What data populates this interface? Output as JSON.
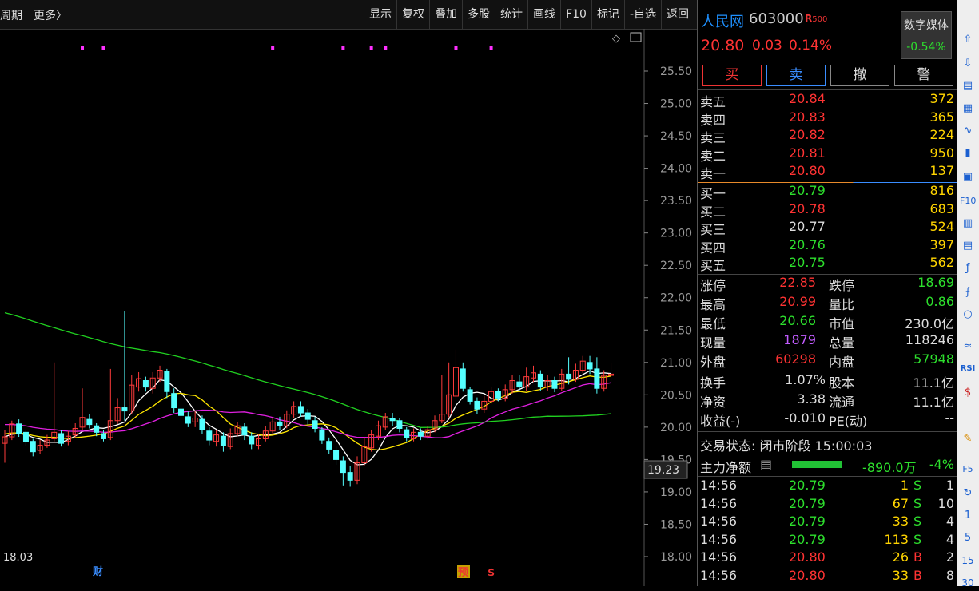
{
  "top": {
    "period": "周期",
    "more": "更多〉",
    "toolbar": [
      "显示",
      "复权",
      "叠加",
      "多股",
      "统计",
      "画线",
      "F10",
      "标记",
      "-自选",
      "返回"
    ]
  },
  "chart_data": {
    "type": "candlestick",
    "y_ticks": [
      "25.50",
      "25.00",
      "24.50",
      "24.00",
      "23.50",
      "23.00",
      "22.50",
      "22.00",
      "21.50",
      "21.00",
      "20.50",
      "20.00",
      "19.50",
      "19.00",
      "18.50",
      "18.00"
    ],
    "ylim": [
      18.0,
      25.5
    ],
    "current_price_label": "19.23",
    "low_label": "18.03",
    "markers": [
      "财",
      "预",
      "$"
    ],
    "candles": [
      [
        19.75,
        19.85,
        19.45,
        19.95
      ],
      [
        19.85,
        20.05,
        19.8,
        20.1
      ],
      [
        20.05,
        19.9,
        19.85,
        20.12
      ],
      [
        19.92,
        19.78,
        19.7,
        19.96
      ],
      [
        19.78,
        19.62,
        19.55,
        19.82
      ],
      [
        19.64,
        19.72,
        19.58,
        19.8
      ],
      [
        19.72,
        19.8,
        19.68,
        19.88
      ],
      [
        19.82,
        19.92,
        19.78,
        21.0
      ],
      [
        19.9,
        19.75,
        19.7,
        19.96
      ],
      [
        19.78,
        19.86,
        19.72,
        19.94
      ],
      [
        19.88,
        19.98,
        19.84,
        20.06
      ],
      [
        20.0,
        20.15,
        19.95,
        20.6
      ],
      [
        20.12,
        20.04,
        19.98,
        20.2
      ],
      [
        20.02,
        19.92,
        19.86,
        20.06
      ],
      [
        19.9,
        19.82,
        19.78,
        19.96
      ],
      [
        19.84,
        20.1,
        19.8,
        20.9
      ],
      [
        20.1,
        20.3,
        20.05,
        20.45
      ],
      [
        20.3,
        20.25,
        20.1,
        21.8
      ],
      [
        20.25,
        20.65,
        20.2,
        20.8
      ],
      [
        20.62,
        20.75,
        20.55,
        20.85
      ],
      [
        20.72,
        20.62,
        20.55,
        20.78
      ],
      [
        20.6,
        20.76,
        20.52,
        20.85
      ],
      [
        20.76,
        20.88,
        20.7,
        20.95
      ],
      [
        20.86,
        20.55,
        20.45,
        20.9
      ],
      [
        20.52,
        20.3,
        20.22,
        20.6
      ],
      [
        20.28,
        20.18,
        20.1,
        20.35
      ],
      [
        20.16,
        20.06,
        20.0,
        20.24
      ],
      [
        20.08,
        20.14,
        20.0,
        20.26
      ],
      [
        20.12,
        19.96,
        19.9,
        20.18
      ],
      [
        19.94,
        19.8,
        19.72,
        20.0
      ],
      [
        19.78,
        19.88,
        19.7,
        19.96
      ],
      [
        19.86,
        19.72,
        19.62,
        19.92
      ],
      [
        19.7,
        19.9,
        19.66,
        19.98
      ],
      [
        19.9,
        20.02,
        19.86,
        20.08
      ],
      [
        20.0,
        19.88,
        19.8,
        20.06
      ],
      [
        19.86,
        19.74,
        19.66,
        19.92
      ],
      [
        19.72,
        19.82,
        19.66,
        19.9
      ],
      [
        19.82,
        19.94,
        19.78,
        20.02
      ],
      [
        19.94,
        20.08,
        19.9,
        20.14
      ],
      [
        20.08,
        20.02,
        19.96,
        20.16
      ],
      [
        20.02,
        20.2,
        19.98,
        20.26
      ],
      [
        20.2,
        20.32,
        20.14,
        20.4
      ],
      [
        20.32,
        20.22,
        20.16,
        20.4
      ],
      [
        20.22,
        20.12,
        20.04,
        20.28
      ],
      [
        20.1,
        19.98,
        19.92,
        20.16
      ],
      [
        19.96,
        19.8,
        19.74,
        20.0
      ],
      [
        19.78,
        19.66,
        19.58,
        19.84
      ],
      [
        19.64,
        19.5,
        19.42,
        19.7
      ],
      [
        19.48,
        19.3,
        19.1,
        19.55
      ],
      [
        19.3,
        19.18,
        19.08,
        19.4
      ],
      [
        19.18,
        19.45,
        19.12,
        19.55
      ],
      [
        19.45,
        19.7,
        19.4,
        19.85
      ],
      [
        19.68,
        19.88,
        19.62,
        19.95
      ],
      [
        19.86,
        20.02,
        19.8,
        20.1
      ],
      [
        20.0,
        20.16,
        19.96,
        20.22
      ],
      [
        20.14,
        20.1,
        20.02,
        20.22
      ],
      [
        20.1,
        19.98,
        19.92,
        20.14
      ],
      [
        19.96,
        19.84,
        19.78,
        20.0
      ],
      [
        19.82,
        19.92,
        19.78,
        19.98
      ],
      [
        19.92,
        19.86,
        19.8,
        19.98
      ],
      [
        19.86,
        19.96,
        19.82,
        20.02
      ],
      [
        19.96,
        20.1,
        19.92,
        20.18
      ],
      [
        20.1,
        20.2,
        20.06,
        20.8
      ],
      [
        20.2,
        20.5,
        20.15,
        21.0
      ],
      [
        20.48,
        20.92,
        20.42,
        21.2
      ],
      [
        20.9,
        20.6,
        20.55,
        21.0
      ],
      [
        20.58,
        20.4,
        20.35,
        20.62
      ],
      [
        20.4,
        20.28,
        20.2,
        20.46
      ],
      [
        20.28,
        20.4,
        20.22,
        20.48
      ],
      [
        20.4,
        20.55,
        20.36,
        20.62
      ],
      [
        20.55,
        20.45,
        20.4,
        20.6
      ],
      [
        20.45,
        20.58,
        20.4,
        20.66
      ],
      [
        20.58,
        20.72,
        20.52,
        20.8
      ],
      [
        20.7,
        20.62,
        20.56,
        20.8
      ],
      [
        20.62,
        20.78,
        20.56,
        20.92
      ],
      [
        20.76,
        20.84,
        20.7,
        20.95
      ],
      [
        20.82,
        20.62,
        20.56,
        20.88
      ],
      [
        20.62,
        20.72,
        20.56,
        20.8
      ],
      [
        20.72,
        20.6,
        20.54,
        20.78
      ],
      [
        20.6,
        20.82,
        20.56,
        20.9
      ],
      [
        20.82,
        20.74,
        20.66,
        21.08
      ],
      [
        20.74,
        20.88,
        20.7,
        20.98
      ],
      [
        20.88,
        21.02,
        20.84,
        21.1
      ],
      [
        21.0,
        20.9,
        20.82,
        21.1
      ],
      [
        20.9,
        20.6,
        20.52,
        21.08
      ],
      [
        20.6,
        20.8,
        20.55,
        20.88
      ],
      [
        20.8,
        20.82,
        20.7,
        20.99
      ]
    ]
  },
  "quote": {
    "name": "人民网",
    "code": "603000",
    "badge": "R",
    "badge_num": "500",
    "price": "20.80",
    "change": "0.03",
    "pct": "0.14%",
    "sector_name": "数字媒体",
    "sector_pct": "-0.54%",
    "buttons": [
      "买",
      "卖",
      "撤",
      "警"
    ]
  },
  "sell": [
    {
      "label": "卖五",
      "price": "20.84",
      "vol": "372"
    },
    {
      "label": "卖四",
      "price": "20.83",
      "vol": "365"
    },
    {
      "label": "卖三",
      "price": "20.82",
      "vol": "224"
    },
    {
      "label": "卖二",
      "price": "20.81",
      "vol": "950"
    },
    {
      "label": "卖一",
      "price": "20.80",
      "vol": "137"
    }
  ],
  "buy": [
    {
      "label": "买一",
      "price": "20.79",
      "vol": "816"
    },
    {
      "label": "买二",
      "price": "20.78",
      "vol": "683"
    },
    {
      "label": "买三",
      "price": "20.77",
      "vol": "524"
    },
    {
      "label": "买四",
      "price": "20.76",
      "vol": "397"
    },
    {
      "label": "买五",
      "price": "20.75",
      "vol": "562"
    }
  ],
  "stats1": [
    {
      "l": "涨停",
      "v": "22.85",
      "l2": "跌停",
      "v2": "18.69"
    },
    {
      "l": "最高",
      "v": "20.99",
      "l2": "量比",
      "v2": "0.86"
    },
    {
      "l": "最低",
      "v": "20.66",
      "l2": "市值",
      "v2": "230.0亿"
    },
    {
      "l": "现量",
      "v": "1879",
      "l2": "总量",
      "v2": "118246"
    },
    {
      "l": "外盘",
      "v": "60298",
      "l2": "内盘",
      "v2": "57948"
    }
  ],
  "stats2": [
    {
      "l": "换手",
      "v": "1.07%",
      "l2": "股本",
      "v2": "11.1亿"
    },
    {
      "l": "净资",
      "v": "3.38",
      "l2": "流通",
      "v2": "11.1亿"
    },
    {
      "l": "收益(-)",
      "v": "-0.010",
      "l2": "PE(动)",
      "v2": "--"
    }
  ],
  "status": "交易状态: 闭市阶段 15:00:03",
  "flow": {
    "label": "主力净额",
    "value": "-890.0万",
    "pct": "-4%"
  },
  "trades": [
    {
      "t": "14:56",
      "p": "20.79",
      "v": "1",
      "s": "S",
      "n": "1"
    },
    {
      "t": "14:56",
      "p": "20.79",
      "v": "67",
      "s": "S",
      "n": "10"
    },
    {
      "t": "14:56",
      "p": "20.79",
      "v": "33",
      "s": "S",
      "n": "4"
    },
    {
      "t": "14:56",
      "p": "20.79",
      "v": "113",
      "s": "S",
      "n": "4"
    },
    {
      "t": "14:56",
      "p": "20.80",
      "v": "26",
      "s": "B",
      "n": "2"
    },
    {
      "t": "14:56",
      "p": "20.80",
      "v": "33",
      "s": "B",
      "n": "8"
    }
  ],
  "side_labels": [
    "F10",
    "F5",
    "RSI",
    "1",
    "5",
    "15",
    "30"
  ]
}
